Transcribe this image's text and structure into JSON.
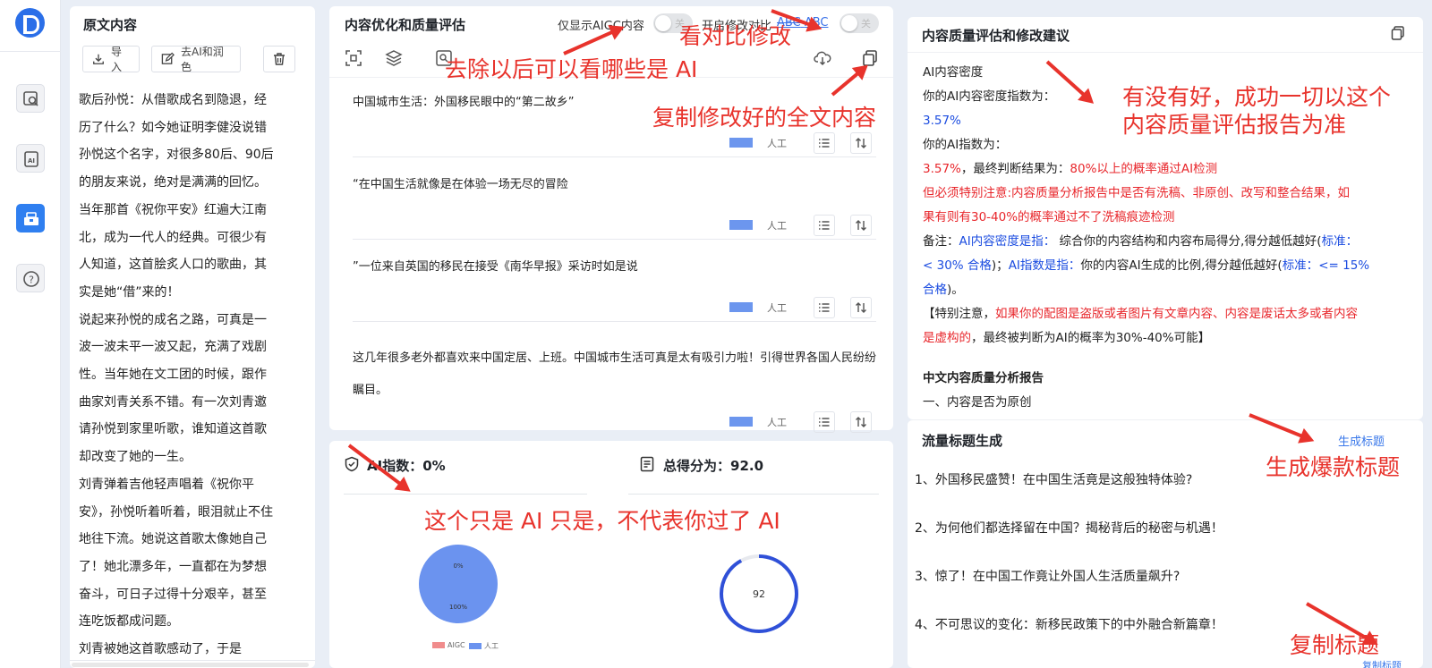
{
  "source_panel": {
    "title": "原文内容",
    "import_label": "导入",
    "rewrite_label": "去AI和润色",
    "lines": [
      "歌后孙悦：从借歌成名到隐退，经",
      "历了什么？如今她证明李健没说错",
      "孙悦这个名字，对很多80后、90后",
      "的朋友来说，绝对是满满的回忆。",
      "当年那首《祝你平安》红遍大江南",
      "北，成为一代人的经典。可很少有",
      "人知道，这首脍炙人口的歌曲，其",
      "实是她“借”来的！",
      "说起来孙悦的成名之路，可真是一",
      "波一波未平一波又起，充满了戏剧",
      "性。当年她在文工团的时候，跟作",
      "曲家刘青关系不错。有一次刘青邀",
      "请孙悦到家里听歌，谁知道这首歌",
      "却改变了她的一生。",
      "刘青弹着吉他轻声唱着《祝你平",
      "安》，孙悦听着听着，眼泪就止不住",
      "地往下流。她说这首歌太像她自己",
      "了！她北漂多年，一直都在为梦想",
      "奋斗，可日子过得十分艰辛，甚至",
      "连吃饭都成问题。",
      "刘青被她这首歌感动了，于是"
    ]
  },
  "optimize_panel": {
    "title": "内容优化和质量评估",
    "aigc_toggle_label": "仅显示AIGC内容",
    "compare_toggle_label": "开启修改对比",
    "abc_struck": "ABC",
    "abc_plain": "ABC",
    "toggle_off": "关",
    "row_tag": "人工",
    "paragraphs": [
      "中国城市生活：外国移民眼中的“第二故乡”",
      "“在中国生活就像是在体验一场无尽的冒险",
      "”一位来自英国的移民在接受《南华早报》采访时如是说",
      "这几年很多老外都喜欢来中国定居、上班。中国城市生活可真是太有吸引力啦！引得世界各国人民纷纷瞩目。"
    ]
  },
  "score_panel": {
    "ai_index_label": "AI指数：",
    "ai_index_value": "0%",
    "total_label": "总得分为：",
    "total_value": "92.0",
    "pie_top_label": "0%",
    "pie_bottom_label": "100%",
    "gauge_value": "92",
    "gauge_fraction": 0.92,
    "legend_aigc": "AIGC",
    "legend_human": "人工",
    "colors": {
      "aigc": "#f08c8c",
      "human": "#6b93ef",
      "gauge": "#2f50d8"
    }
  },
  "report_panel": {
    "title": "内容质量评估和修改建议",
    "density_heading": "AI内容密度",
    "density_label": "你的AI内容密度指数为：",
    "density_value": "3.57%",
    "index_label": "你的AI指数为：",
    "index_value": "3.57%",
    "index_mid": "，最终判断结果为：",
    "index_result": "80%以上的概率通过AI检测",
    "warning_1": "但必须特别注意:内容质量分析报告中是否有洗稿、非原创、改写和整合结果，如",
    "warning_2": "果有则有30-40%的概率通过不了洗稿痕迹检测",
    "note_prefix": "备注：",
    "note_density_key": "AI内容密度是指：",
    "note_density_text": " 综合你的内容结构和内容布局得分,得分越低越好(",
    "note_std1_label": "标准：",
    "note_std1_value": "< 30% 合格",
    "note_mid": ")；",
    "note_index_key": "AI指数是指：",
    "note_index_text": "你的内容AI生成的比例,得分越低越好(",
    "note_std2_label": "标准：",
    "note_std2_value": "<= 15%",
    "note_std2_tail": "合格",
    "note_end": ")。",
    "special_prefix": "【特别注意，",
    "special_red_1": "如果你的配图是盗版或者图片有文章内容、内容是废话太多或者内容",
    "special_red_2": "是虚构的",
    "special_tail": "，最终被判断为AI的概率为30%-40%可能】",
    "report_heading": "中文内容质量分析报告",
    "report_item_1": "一、内容是否为原创"
  },
  "titles_panel": {
    "title": "流量标题生成",
    "generate_link": "生成标题",
    "copy_link": "复制标题",
    "items": [
      "1、外国移民盛赞！在中国生活竟是这般独特体验?",
      "2、为何他们都选择留在中国？揭秘背后的秘密与机遇！",
      "3、惊了！在中国工作竟让外国人生活质量飙升?",
      "4、不可思议的变化：新移民政策下的中外融合新篇章！"
    ]
  },
  "annotations": {
    "compare": "看对比修改",
    "remove_ai": "去除以后可以看哪些是 AI",
    "copy_full": "复制修改好的全文内容",
    "report_1": "有没有好，成功一切以这个",
    "report_2": "内容质量评估报告为准",
    "gen_title": "生成爆款标题",
    "ai_note": "这个只是 AI 只是，不代表你过了 AI",
    "copy_title": "复制标题"
  }
}
